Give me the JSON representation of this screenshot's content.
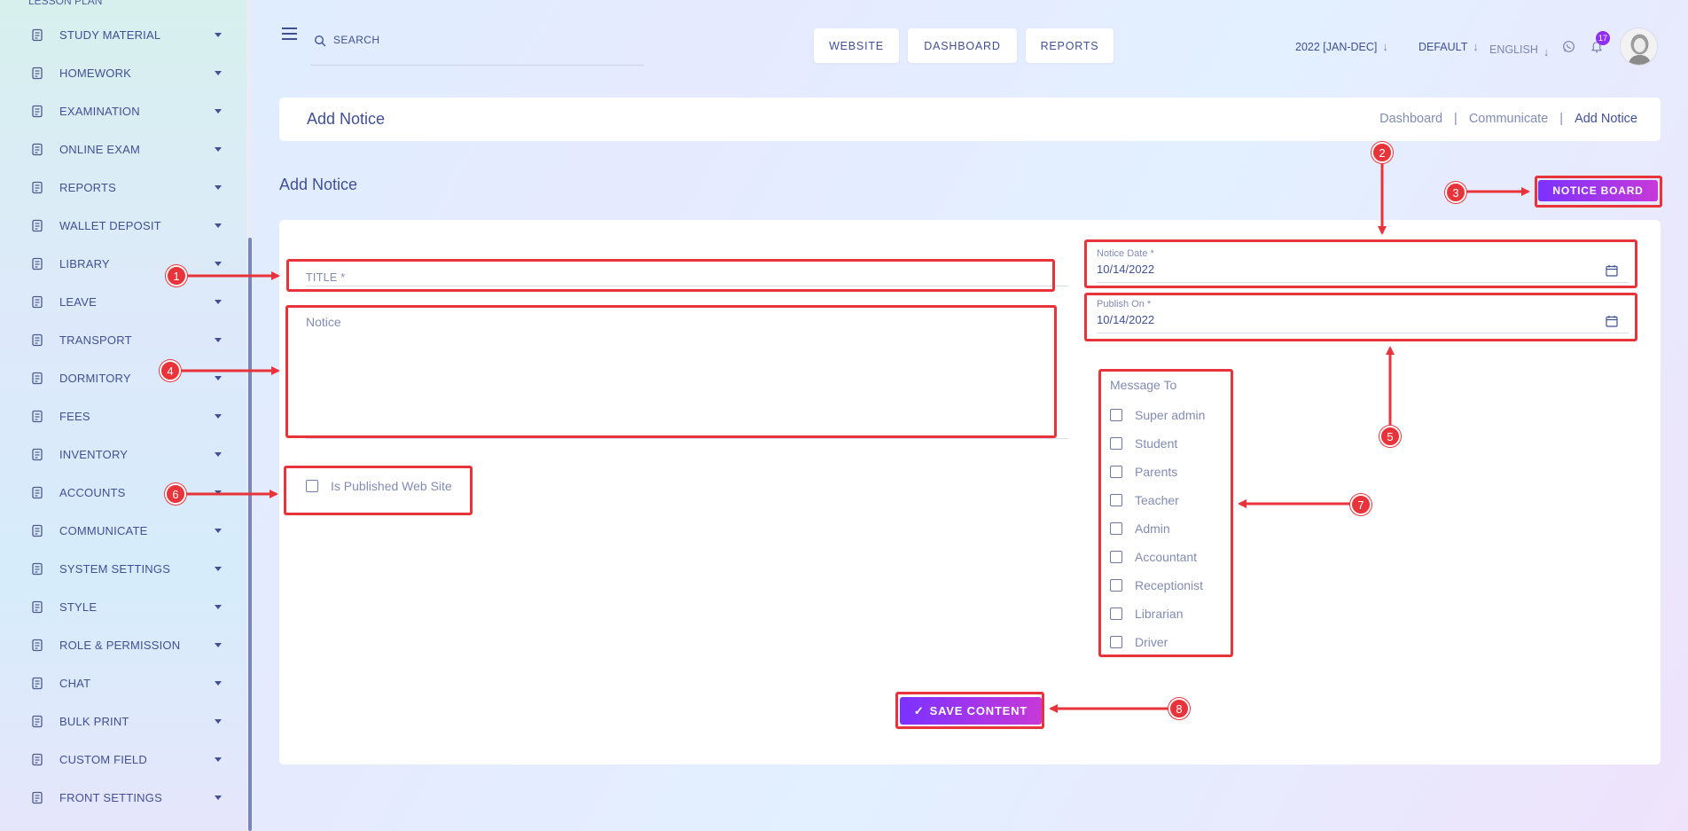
{
  "sidebar": {
    "partial_item": "LESSON PLAN",
    "items": [
      {
        "label": "STUDY MATERIAL",
        "icon": "study-material-icon"
      },
      {
        "label": "HOMEWORK",
        "icon": "homework-icon"
      },
      {
        "label": "EXAMINATION",
        "icon": "examination-icon"
      },
      {
        "label": "ONLINE EXAM",
        "icon": "online-exam-icon"
      },
      {
        "label": "REPORTS",
        "icon": "reports-icon"
      },
      {
        "label": "WALLET DEPOSIT",
        "icon": "wallet-icon"
      },
      {
        "label": "LIBRARY",
        "icon": "library-icon"
      },
      {
        "label": "LEAVE",
        "icon": "leave-icon"
      },
      {
        "label": "TRANSPORT",
        "icon": "transport-icon"
      },
      {
        "label": "DORMITORY",
        "icon": "dormitory-icon"
      },
      {
        "label": "FEES",
        "icon": "fees-icon"
      },
      {
        "label": "INVENTORY",
        "icon": "inventory-icon"
      },
      {
        "label": "ACCOUNTS",
        "icon": "accounts-icon"
      },
      {
        "label": "COMMUNICATE",
        "icon": "communicate-icon"
      },
      {
        "label": "SYSTEM SETTINGS",
        "icon": "settings-icon"
      },
      {
        "label": "STYLE",
        "icon": "style-icon"
      },
      {
        "label": "ROLE & PERMISSION",
        "icon": "role-icon"
      },
      {
        "label": "CHAT",
        "icon": "chat-icon"
      },
      {
        "label": "BULK PRINT",
        "icon": "print-icon"
      },
      {
        "label": "CUSTOM FIELD",
        "icon": "custom-field-icon"
      },
      {
        "label": "FRONT SETTINGS",
        "icon": "front-settings-icon"
      }
    ]
  },
  "header": {
    "search_placeholder": "SEARCH",
    "buttons": {
      "website": "WEBSITE",
      "dashboard": "DASHBOARD",
      "reports": "REPORTS"
    },
    "session": "2022 [JAN-DEC]",
    "theme": "DEFAULT",
    "language": "ENGLISH",
    "notification_count": "17"
  },
  "breadcrumb": {
    "title": "Add Notice",
    "links": [
      "Dashboard",
      "Communicate",
      "Add Notice"
    ],
    "separator": "|"
  },
  "section": {
    "title": "Add Notice",
    "notice_board_button": "NOTICE BOARD"
  },
  "form": {
    "title_placeholder": "TITLE *",
    "notice_placeholder": "Notice",
    "published_web_label": "Is Published Web Site",
    "notice_date_label": "Notice Date *",
    "notice_date_value": "10/14/2022",
    "publish_on_label": "Publish On *",
    "publish_on_value": "10/14/2022",
    "message_to_title": "Message To",
    "message_to_options": [
      "Super admin",
      "Student",
      "Parents",
      "Teacher",
      "Admin",
      "Accountant",
      "Receptionist",
      "Librarian",
      "Driver"
    ],
    "save_button": "SAVE CONTENT",
    "save_icon": "✓"
  },
  "annotations": [
    "1",
    "2",
    "3",
    "4",
    "5",
    "6",
    "7",
    "8"
  ],
  "colors": {
    "primary_text": "#415094",
    "muted_text": "#828bb2",
    "gradient_start": "#7c32ff",
    "gradient_end": "#c738d8",
    "annotation_red": "#e8333a",
    "badge_purple": "#8f2ef5"
  }
}
